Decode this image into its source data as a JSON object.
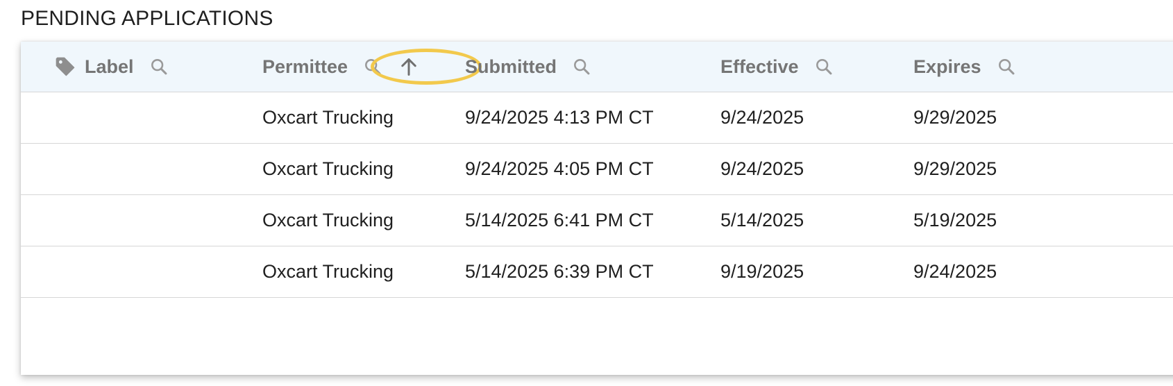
{
  "page": {
    "title": "PENDING APPLICATIONS"
  },
  "table": {
    "columns": [
      {
        "key": "label",
        "title": "Label",
        "icon": "tag-icon"
      },
      {
        "key": "permittee",
        "title": "Permittee",
        "sort": "ascending",
        "sort_icon": "arrow-up-icon"
      },
      {
        "key": "submitted",
        "title": "Submitted"
      },
      {
        "key": "effective",
        "title": "Effective"
      },
      {
        "key": "expires",
        "title": "Expires"
      }
    ],
    "rows": [
      {
        "label": "",
        "permittee": "Oxcart Trucking",
        "submitted": "9/24/2025 4:13 PM CT",
        "effective": "9/24/2025",
        "expires": "9/29/2025"
      },
      {
        "label": "",
        "permittee": "Oxcart Trucking",
        "submitted": "9/24/2025 4:05 PM CT",
        "effective": "9/24/2025",
        "expires": "9/29/2025"
      },
      {
        "label": "",
        "permittee": "Oxcart Trucking",
        "submitted": "5/14/2025 6:41 PM CT",
        "effective": "5/14/2025",
        "expires": "5/19/2025"
      },
      {
        "label": "",
        "permittee": "Oxcart Trucking",
        "submitted": "5/14/2025 6:39 PM CT",
        "effective": "9/19/2025",
        "expires": "9/24/2025"
      }
    ]
  },
  "colors": {
    "header_bg": "#f0f7fc",
    "highlight": "#f2c94c",
    "header_text": "#757575",
    "body_text": "#1f1f1f"
  }
}
